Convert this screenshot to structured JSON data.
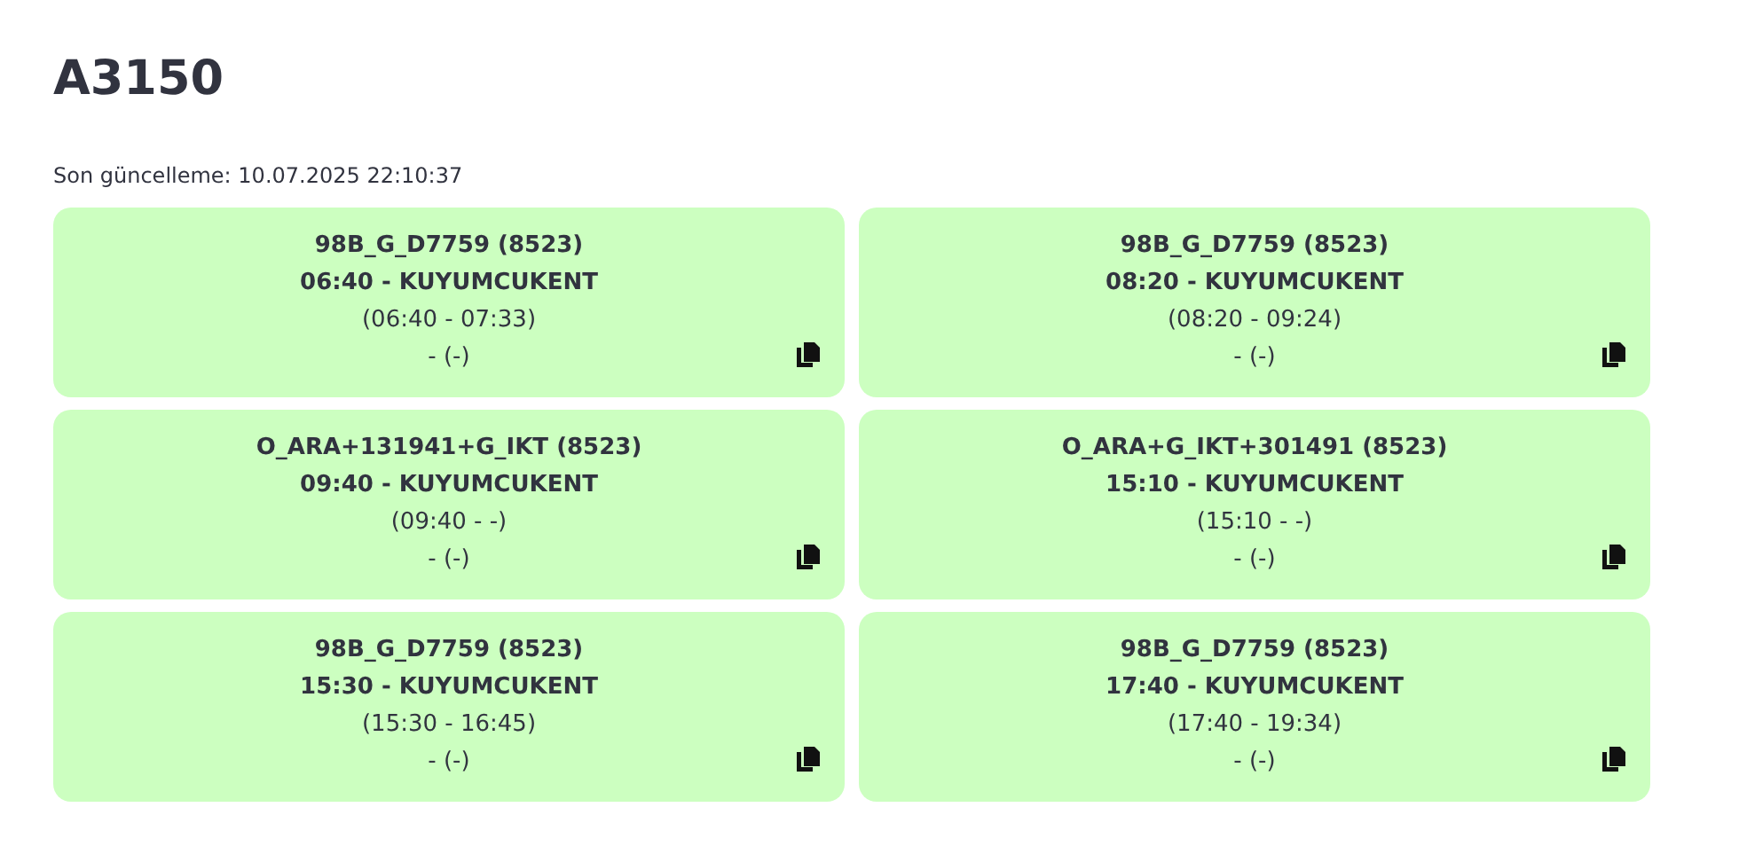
{
  "title": "A3150",
  "last_update": "Son güncelleme: 10.07.2025 22:10:37",
  "trips": [
    {
      "code": "98B_G_D7759 (8523)",
      "departure": "06:40 - KUYUMCUKENT",
      "span": "(06:40 - 07:33)",
      "extra": "- (-)"
    },
    {
      "code": "98B_G_D7759 (8523)",
      "departure": "08:20 - KUYUMCUKENT",
      "span": "(08:20 - 09:24)",
      "extra": "- (-)"
    },
    {
      "code": "O_ARA+131941+G_IKT (8523)",
      "departure": "09:40 - KUYUMCUKENT",
      "span": "(09:40 - -)",
      "extra": "- (-)"
    },
    {
      "code": "O_ARA+G_IKT+301491 (8523)",
      "departure": "15:10 - KUYUMCUKENT",
      "span": "(15:10 - -)",
      "extra": "- (-)"
    },
    {
      "code": "98B_G_D7759 (8523)",
      "departure": "15:30 - KUYUMCUKENT",
      "span": "(15:30 - 16:45)",
      "extra": "- (-)"
    },
    {
      "code": "98B_G_D7759 (8523)",
      "departure": "17:40 - KUYUMCUKENT",
      "span": "(17:40 - 19:34)",
      "extra": "- (-)"
    }
  ]
}
